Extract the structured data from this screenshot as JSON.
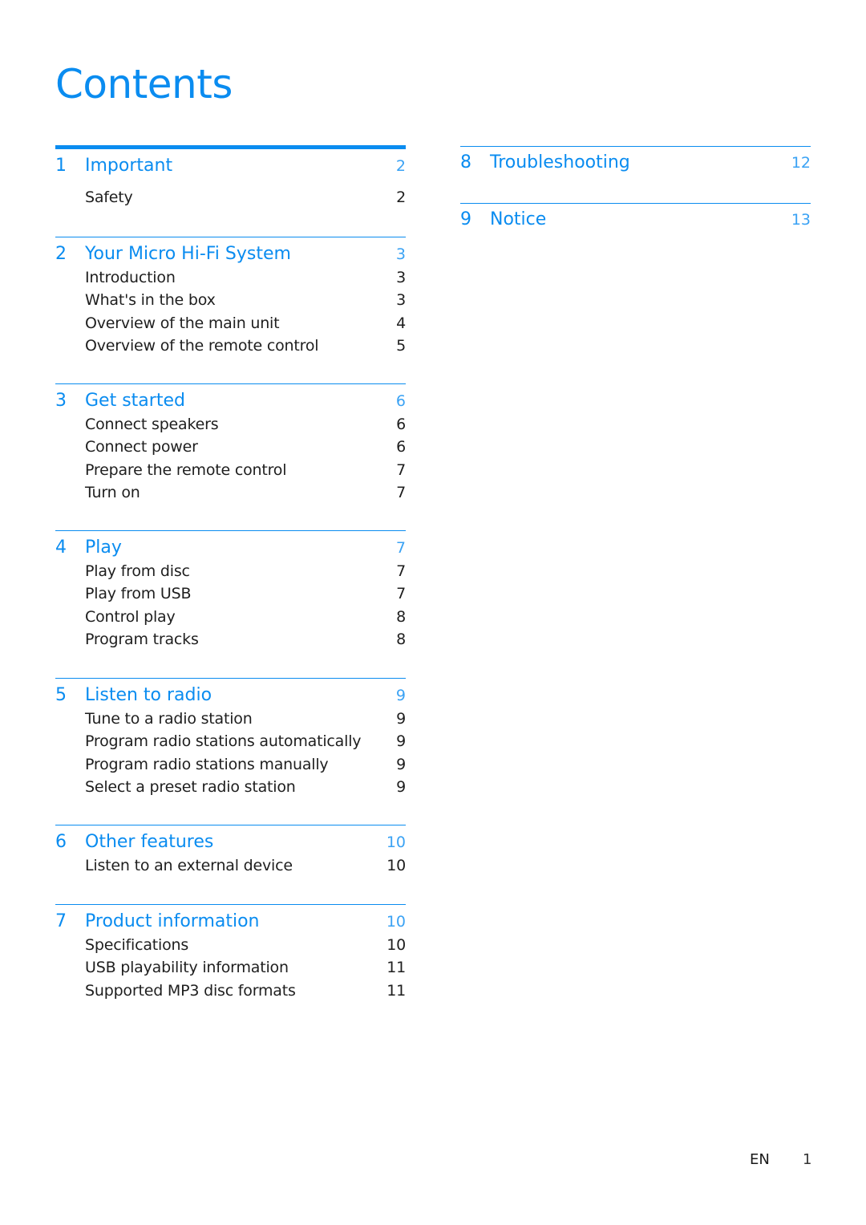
{
  "title": "Contents",
  "accent_color": "#0a8cf0",
  "left_column": [
    {
      "num": "1",
      "title": "Important",
      "page": "2",
      "items": [
        {
          "label": "Safety",
          "page": "2"
        }
      ]
    },
    {
      "num": "2",
      "title": "Your Micro Hi-Fi System",
      "page": "3",
      "items": [
        {
          "label": "Introduction",
          "page": "3"
        },
        {
          "label": "What's in the box",
          "page": "3"
        },
        {
          "label": "Overview of the main unit",
          "page": "4"
        },
        {
          "label": "Overview of the remote control",
          "page": "5"
        }
      ]
    },
    {
      "num": "3",
      "title": "Get started",
      "page": "6",
      "items": [
        {
          "label": "Connect speakers",
          "page": "6"
        },
        {
          "label": "Connect power",
          "page": "6"
        },
        {
          "label": "Prepare the remote control",
          "page": "7"
        },
        {
          "label": "Turn on",
          "page": "7"
        }
      ]
    },
    {
      "num": "4",
      "title": "Play",
      "page": "7",
      "items": [
        {
          "label": "Play from disc",
          "page": "7"
        },
        {
          "label": "Play from USB",
          "page": "7"
        },
        {
          "label": "Control play",
          "page": "8"
        },
        {
          "label": "Program tracks",
          "page": "8"
        }
      ]
    },
    {
      "num": "5",
      "title": "Listen to radio",
      "page": "9",
      "items": [
        {
          "label": "Tune to a radio station",
          "page": "9"
        },
        {
          "label": "Program radio stations automatically",
          "page": "9"
        },
        {
          "label": "Program radio stations manually",
          "page": "9"
        },
        {
          "label": "Select a preset radio station",
          "page": "9"
        }
      ]
    },
    {
      "num": "6",
      "title": "Other features",
      "page": "10",
      "items": [
        {
          "label": "Listen to an external device",
          "page": "10"
        }
      ]
    },
    {
      "num": "7",
      "title": "Product information",
      "page": "10",
      "items": [
        {
          "label": "Specifications",
          "page": "10"
        },
        {
          "label": "USB playability information",
          "page": "11"
        },
        {
          "label": "Supported MP3 disc formats",
          "page": "11"
        }
      ]
    }
  ],
  "right_column": [
    {
      "num": "8",
      "title": "Troubleshooting",
      "page": "12",
      "items": []
    },
    {
      "num": "9",
      "title": "Notice",
      "page": "13",
      "items": []
    }
  ],
  "footer": {
    "language": "EN",
    "page_number": "1"
  }
}
